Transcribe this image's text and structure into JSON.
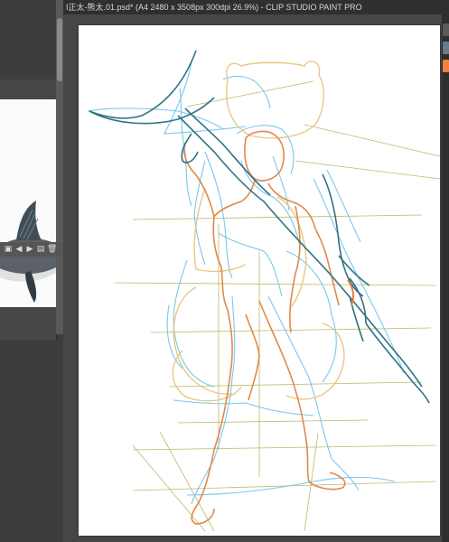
{
  "window": {
    "title": "I正太-熊太.01.psd* (A4 2480 x 3508px 300dpi 26.9%)  - CLIP STUDIO PAINT PRO"
  },
  "reference_panel": {
    "toolbar_icons": [
      "layer-icon",
      "prev-icon",
      "next-icon",
      "new-icon",
      "trash-icon"
    ]
  },
  "colors": {
    "paper": "#ffffff",
    "workspace": "#464646",
    "sketch_blue": "#6cc7ec",
    "sketch_orange": "#e0884a",
    "sketch_yellow": "#e8c57a",
    "perspective_olive": "#a6a64e",
    "ink_teal": "#2c6f7e",
    "accent_orange": "#f0803c"
  }
}
